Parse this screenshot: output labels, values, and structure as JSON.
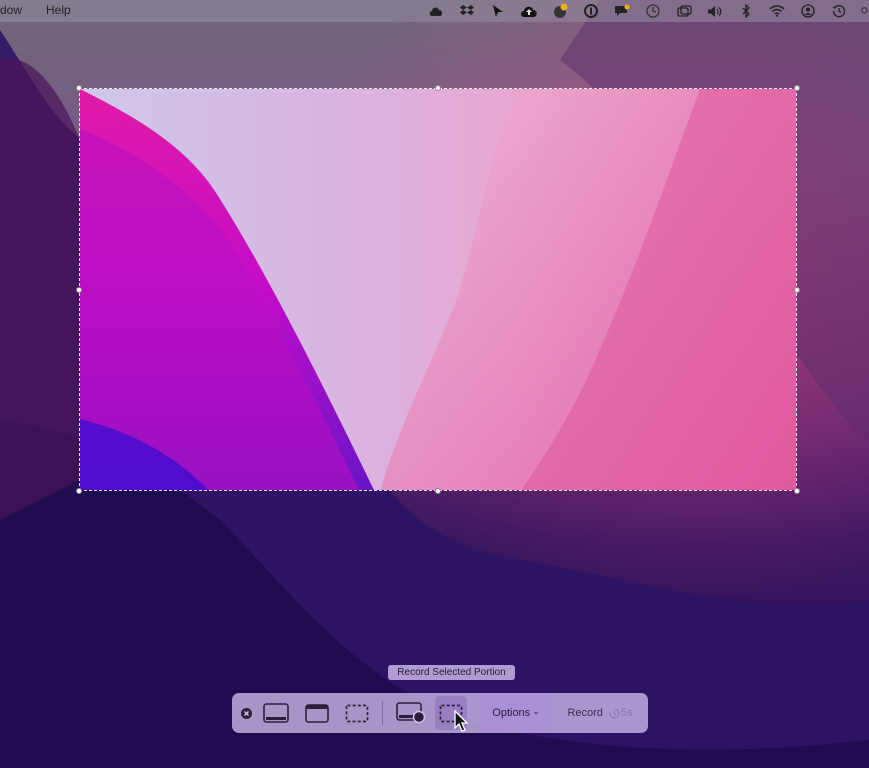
{
  "menubar": {
    "menus": [
      "dow",
      "Help"
    ],
    "status_icons": [
      "cloud-icon",
      "dropbox-icon",
      "cursor-icon",
      "cloud-upload-icon",
      "notification-badge-icon",
      "onepassword-icon",
      "chat-icon",
      "clock-icon",
      "window-icon",
      "volume-icon",
      "bluetooth-icon",
      "wifi-icon",
      "user-icon",
      "time-machine-icon",
      "search-icon"
    ]
  },
  "tooltip": "Record Selected Portion",
  "toolbar": {
    "options_label": "Options",
    "options_chevron": "⌄",
    "record_label": "Record",
    "timer_label": "5s"
  },
  "colors": {
    "selection_border": "#ffffff",
    "toolbar_bg": "#cdbeeb",
    "tooltip_bg": "#c8b4e6"
  }
}
